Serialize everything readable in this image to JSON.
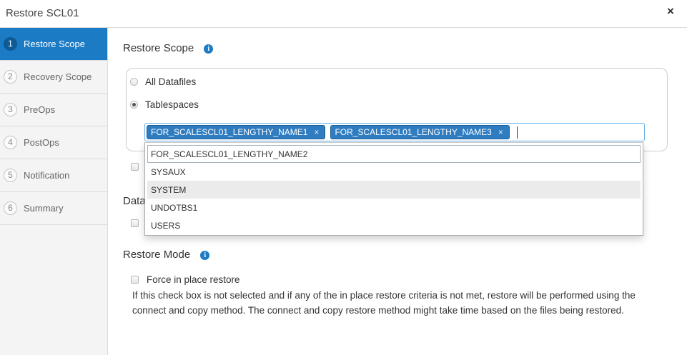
{
  "dialog": {
    "title": "Restore SCL01",
    "close_icon": "close-icon"
  },
  "steps": [
    {
      "number": "1",
      "label": "Restore Scope",
      "active": true
    },
    {
      "number": "2",
      "label": "Recovery Scope",
      "active": false
    },
    {
      "number": "3",
      "label": "PreOps",
      "active": false
    },
    {
      "number": "4",
      "label": "PostOps",
      "active": false
    },
    {
      "number": "5",
      "label": "Notification",
      "active": false
    },
    {
      "number": "6",
      "label": "Summary",
      "active": false
    }
  ],
  "restore_scope": {
    "heading": "Restore Scope",
    "info_icon": "info-icon",
    "options": [
      {
        "label": "All Datafiles",
        "selected": false
      },
      {
        "label": "Tablespaces",
        "selected": true
      }
    ],
    "tablespace_select": {
      "selected_tags": [
        {
          "label": "FOR_SCALESCL01_LENGTHY_NAME1",
          "remove_icon": "remove-icon"
        },
        {
          "label": "FOR_SCALESCL01_LENGTHY_NAME3",
          "remove_icon": "remove-icon"
        }
      ],
      "dropdown_options": [
        {
          "label": "FOR_SCALESCL01_LENGTHY_NAME2",
          "focused": true,
          "highlighted": false
        },
        {
          "label": "SYSAUX",
          "focused": false,
          "highlighted": false
        },
        {
          "label": "SYSTEM",
          "focused": false,
          "highlighted": true
        },
        {
          "label": "UNDOTBS1",
          "focused": false,
          "highlighted": false
        },
        {
          "label": "USERS",
          "focused": false,
          "highlighted": false
        }
      ]
    },
    "obscured_checkbox": {
      "checked": false
    }
  },
  "partially_hidden_section": {
    "heading": "Data",
    "checkbox": {
      "checked": false
    }
  },
  "restore_mode": {
    "heading": "Restore Mode",
    "info_icon": "info-icon",
    "force_in_place": {
      "label": "Force in place restore",
      "checked": false
    },
    "help_text": "If this check box is not selected and if any of the in place restore criteria is not met, restore will be performed using the connect and copy method. The connect and copy restore method might take time based on the files being restored."
  },
  "colors": {
    "accent": "#1b7bc4",
    "accent_dark": "#0d5a94",
    "tag_bg": "#2f7cc0",
    "tag_border": "#1f5e96",
    "highlight_bg": "#ebebeb",
    "focus_border": "#66afe9"
  }
}
